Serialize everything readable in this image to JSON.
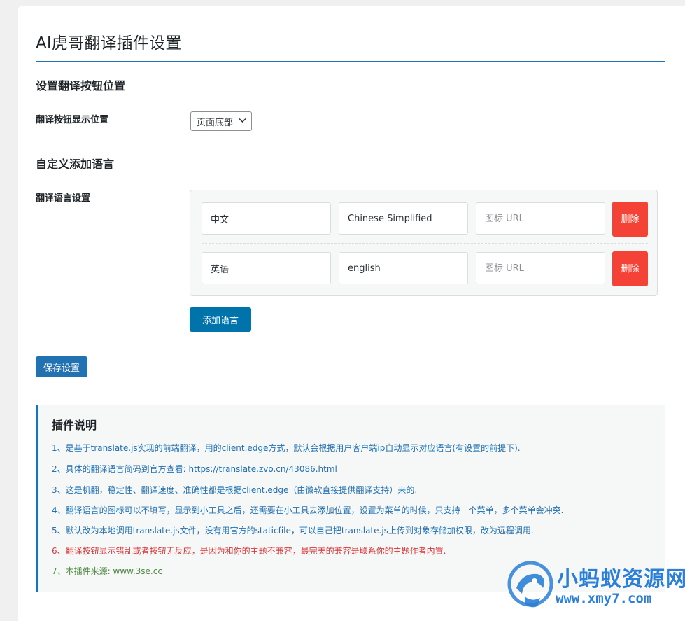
{
  "page": {
    "title": "AI虎哥翻译插件设置"
  },
  "position_section": {
    "heading": "设置翻译按钮位置",
    "field_label": "翻译按钮显示位置",
    "select_value": "页面底部"
  },
  "language_section": {
    "heading": "自定义添加语言",
    "field_label": "翻译语言设置",
    "rows": [
      {
        "name": "中文",
        "code": "Chinese Simplified",
        "icon_placeholder": "图标 URL",
        "delete_label": "删除"
      },
      {
        "name": "英语",
        "code": "english",
        "icon_placeholder": "图标 URL",
        "delete_label": "删除"
      }
    ],
    "add_label": "添加语言"
  },
  "save_label": "保存设置",
  "notes": {
    "title": "插件说明",
    "items": [
      {
        "text": "1、是基于translate.js实现的前端翻译，用的client.edge方式，默认会根据用户客户端ip自动显示对应语言(有设置的前提下)."
      },
      {
        "text": "2、具体的翻译语言简码到官方查看: ",
        "link": "https://translate.zvo.cn/43086.html"
      },
      {
        "text": "3、这是机翻，稳定性、翻译速度、准确性都是根据client.edge（由微软直接提供翻译支持）来的."
      },
      {
        "text": "4、翻译语言的图标可以不填写，显示到小工具之后，还需要在小工具去添加位置，设置为菜单的时候，只支持一个菜单，多个菜单会冲突."
      },
      {
        "text": "5、默认改为本地调用translate.js文件，没有用官方的staticfile，可以自己把translate.js上传到对象存储加权限，改为远程调用."
      },
      {
        "text": "6、翻译按钮显示错乱或者按钮无反应，是因为和你的主题不兼容，最完美的兼容是联系你的主题作者内置."
      },
      {
        "text": "7、本插件来源: ",
        "link": "www.3se.cc"
      }
    ]
  },
  "watermark": {
    "name": "小蚂蚁资源网",
    "url": "www.xmy7.com"
  },
  "colors": {
    "primary": "#2271b1",
    "add_button": "#0073aa",
    "delete_button": "#f44336",
    "warning_text": "#d63638",
    "source_text": "#4a8a3a",
    "watermark": "#2b7fd4"
  }
}
